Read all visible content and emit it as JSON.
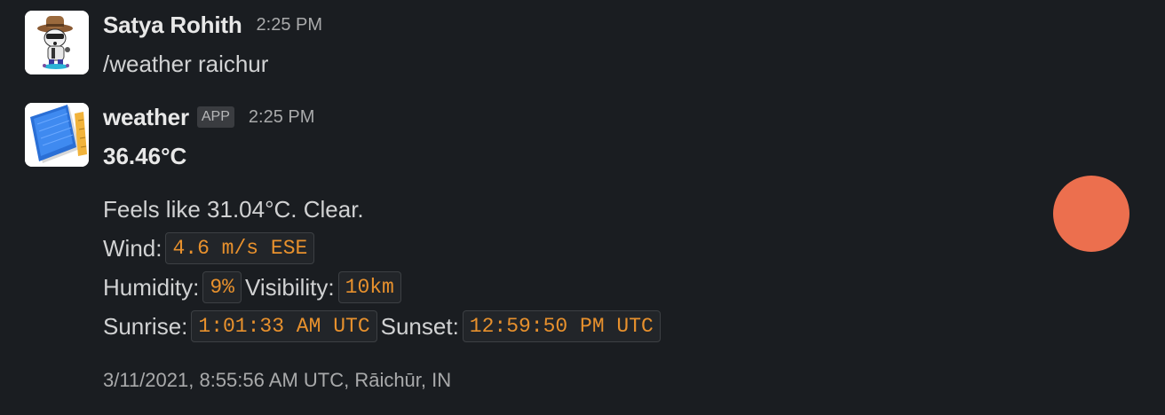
{
  "messages": [
    {
      "sender": "Satya Rohith",
      "time": "2:25 PM",
      "text": "/weather raichur"
    },
    {
      "sender": "weather",
      "badge": "APP",
      "time": "2:25 PM",
      "temperature": "36.46°C",
      "feels": "Feels like 31.04°C. Clear.",
      "wind_label": "Wind:",
      "wind_value": "4.6 m/s ESE",
      "humidity_label": "Humidity:",
      "humidity_value": "9%",
      "visibility_label": "Visibility:",
      "visibility_value": "10km",
      "sunrise_label": "Sunrise:",
      "sunrise_value": "1:01:33 AM UTC",
      "sunset_label": "Sunset:",
      "sunset_value": "12:59:50 PM UTC",
      "footer": "3/11/2021, 8:55:56 AM UTC, Rāichūr, IN"
    }
  ],
  "colors": {
    "background": "#1a1d21",
    "code_text": "#e8912d",
    "dot": "#ec6f4e"
  },
  "icons": {
    "user_avatar": "cowboy-character-avatar",
    "app_avatar": "blue-notebook-pencil-icon"
  }
}
